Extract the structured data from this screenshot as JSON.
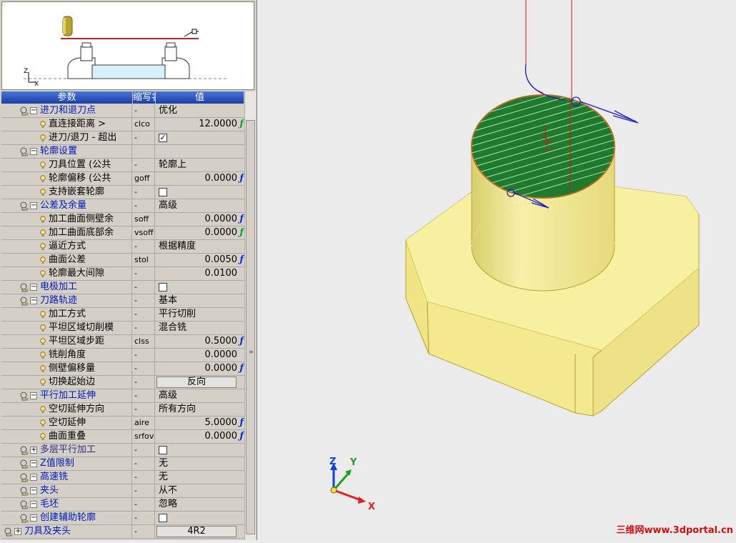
{
  "columns": {
    "param": "参数",
    "abbr": "缩写名",
    "value": "值"
  },
  "preview": {
    "axis_z": "Z",
    "axis_x": "X"
  },
  "rows": [
    {
      "kind": "group",
      "expanded": true,
      "label": "进刀和退刀点",
      "abbr": "-",
      "value": "优化"
    },
    {
      "kind": "param",
      "label": "直连接距离 >",
      "abbr": "clco",
      "num": "12.0000",
      "fx": "green"
    },
    {
      "kind": "param",
      "label": "进刀/退刀 - 超出",
      "abbr": "-",
      "check": true
    },
    {
      "kind": "group",
      "expanded": true,
      "label": "轮廓设置",
      "abbr": "",
      "value": ""
    },
    {
      "kind": "param",
      "label": "刀具位置 (公共",
      "abbr": "-",
      "value": "轮廓上"
    },
    {
      "kind": "param",
      "label": "轮廓偏移 (公共",
      "abbr": "goff",
      "num": "0.0000",
      "fx": "blue"
    },
    {
      "kind": "param",
      "label": "支持嵌套轮廓",
      "abbr": "-",
      "check": false
    },
    {
      "kind": "group",
      "expanded": true,
      "label": "公差及余量",
      "abbr": "-",
      "value": "高级"
    },
    {
      "kind": "param",
      "label": "加工曲面侧壁余",
      "abbr": "soff",
      "num": "0.0000",
      "fx": "blue"
    },
    {
      "kind": "param",
      "label": "加工曲面底部余",
      "abbr": "vsoff",
      "num": "0.0000",
      "fx": "green"
    },
    {
      "kind": "param",
      "label": "逼近方式",
      "abbr": "-",
      "value": "根据精度"
    },
    {
      "kind": "param",
      "label": "曲面公差",
      "abbr": "stol",
      "num": "0.0050",
      "fx": "blue"
    },
    {
      "kind": "param",
      "label": "轮廓最大间隙",
      "abbr": "-",
      "num": "0.0100"
    },
    {
      "kind": "group",
      "expanded": true,
      "label": "电极加工",
      "abbr": "-",
      "check": false
    },
    {
      "kind": "group",
      "expanded": true,
      "label": "刀路轨迹",
      "abbr": "-",
      "value": "基本"
    },
    {
      "kind": "param",
      "label": "加工方式",
      "abbr": "-",
      "value": "平行切削"
    },
    {
      "kind": "param",
      "label": "平坦区域切削模",
      "abbr": "-",
      "value": "混合铣"
    },
    {
      "kind": "param",
      "label": "平坦区域步距",
      "abbr": "clss",
      "num": "0.5000",
      "fx": "blue"
    },
    {
      "kind": "param",
      "label": "铣削角度",
      "abbr": "-",
      "num": "0.0000"
    },
    {
      "kind": "param",
      "label": "侧壁偏移量",
      "abbr": "-",
      "num": "0.0000",
      "fx": "blue"
    },
    {
      "kind": "param",
      "label": "切换起始边",
      "abbr": "-",
      "button": "反向"
    },
    {
      "kind": "group",
      "expanded": true,
      "label": "平行加工延伸",
      "abbr": "-",
      "value": "高级"
    },
    {
      "kind": "param",
      "label": "空切延伸方向",
      "abbr": "-",
      "value": "所有方向"
    },
    {
      "kind": "param",
      "label": "空切延伸",
      "abbr": "aire",
      "num": "5.0000",
      "fx": "blue"
    },
    {
      "kind": "param",
      "label": "曲面重叠",
      "abbr": "srfov",
      "num": "0.0000",
      "fx": "blue"
    },
    {
      "kind": "group",
      "expanded": false,
      "dim": true,
      "label": "多层平行加工",
      "abbr": "-",
      "check": false
    },
    {
      "kind": "group",
      "expanded": true,
      "label": "Z值限制",
      "abbr": "-",
      "value": "无"
    },
    {
      "kind": "group",
      "expanded": true,
      "label": "高速铣",
      "abbr": "-",
      "value": "无"
    },
    {
      "kind": "group",
      "expanded": true,
      "label": "夹头",
      "abbr": "-",
      "value": "从不"
    },
    {
      "kind": "group",
      "expanded": true,
      "label": "毛坯",
      "abbr": "-",
      "value": "忽略"
    },
    {
      "kind": "group",
      "expanded": true,
      "label": "创建辅助轮廓",
      "abbr": "-",
      "check": false
    },
    {
      "kind": "root",
      "expanded": false,
      "label": "刀具及夹头",
      "abbr": "-",
      "button": "4R2"
    }
  ],
  "triad": {
    "x": "X",
    "y": "Y",
    "z": "Z"
  },
  "colors": {
    "part": "#f5ee98",
    "part_edge": "#b9a33c",
    "toolpath_fill": "#1f7a2e",
    "toolpath_line": "#a8e4a8",
    "tool_path": "#e01010",
    "arrow": "#2020c0",
    "header": "#2a4cc0"
  },
  "watermark": "三维网www.3dportal.cn"
}
